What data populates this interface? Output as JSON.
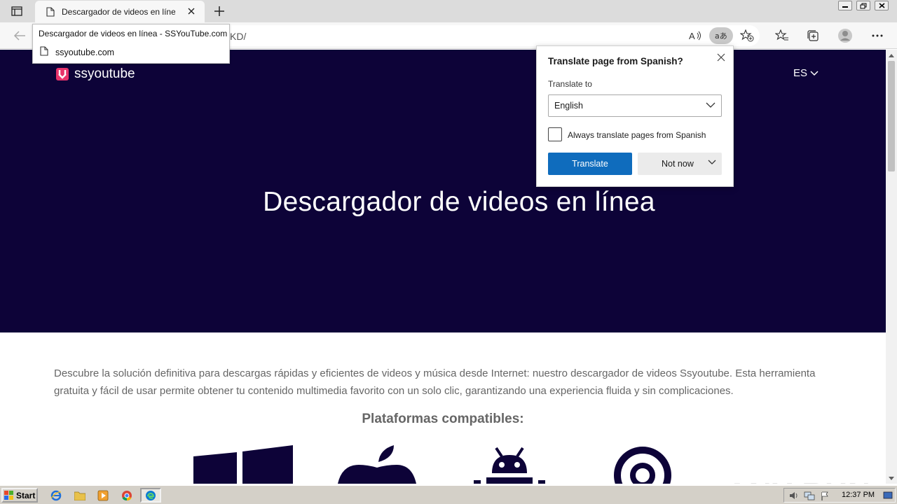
{
  "browser": {
    "tab": {
      "title": "Descargador de videos en línea - SSYouTube.com"
    },
    "address": {
      "url_visible": "KD/"
    },
    "tooltip": {
      "title": "Descargador de videos en línea - SSYouTube.com",
      "url": "ssyoutube.com"
    }
  },
  "translate_popup": {
    "title": "Translate page from Spanish?",
    "translate_to_label": "Translate to",
    "selected_language": "English",
    "always_translate_label": "Always translate pages from Spanish",
    "always_translate_checked": false,
    "translate_button": "Translate",
    "not_now_button": "Not now"
  },
  "page": {
    "logo_text": "ssyoutube",
    "language": "ES",
    "hero_title": "Descargador de videos en línea",
    "intro": "Descubre la solución definitiva para descargas rápidas y eficientes de videos y música desde Internet: nuestro descargador de videos Ssyoutube. Esta herramienta gratuita y fácil de usar permite obtener tu contenido multimedia favorito con un solo clic, garantizando una experiencia fluida y sin complicaciones.",
    "platforms_heading": "Plataformas compatibles:",
    "platform_icons": [
      "windows-icon",
      "apple-icon",
      "android-icon",
      "ubuntu-icon"
    ],
    "colors": {
      "hero_bg": "#0d0338",
      "logo_accent": "#e8336b",
      "button_primary": "#0f6cbd"
    }
  },
  "watermark": {
    "text": "ANY RUN"
  },
  "taskbar": {
    "start_label": "Start",
    "clock": "12:37 PM",
    "quick_launch": [
      "internet-explorer-icon",
      "folder-icon",
      "media-player-icon",
      "chrome-icon",
      "edge-icon"
    ]
  }
}
